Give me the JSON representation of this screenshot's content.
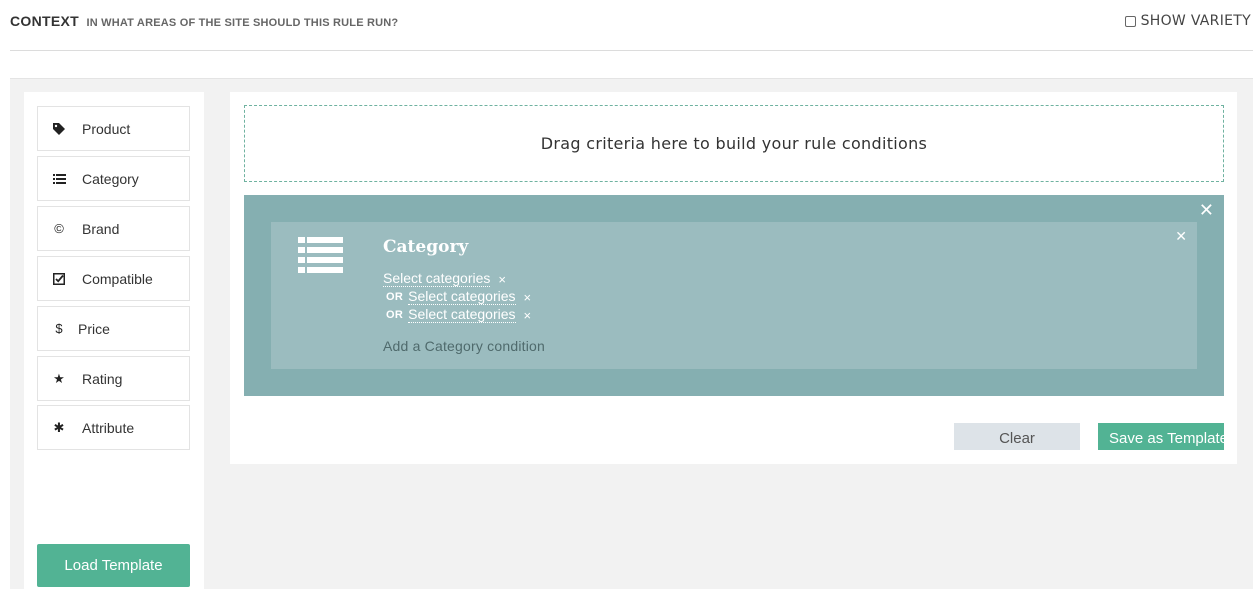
{
  "header": {
    "title": "CONTEXT",
    "subtitle": "IN WHAT AREAS OF THE SITE SHOULD THIS RULE RUN?",
    "show_variety_label": "SHOW VARIETY",
    "show_variety_checked": false
  },
  "sidebar": {
    "items": [
      {
        "label": "Product",
        "icon": "tag-icon"
      },
      {
        "label": "Category",
        "icon": "list-icon"
      },
      {
        "label": "Brand",
        "icon": "copyright-icon"
      },
      {
        "label": "Compatible",
        "icon": "check-square-icon"
      },
      {
        "label": "Price",
        "icon": "dollar-icon"
      },
      {
        "label": "Rating",
        "icon": "star-icon"
      },
      {
        "label": "Attribute",
        "icon": "asterisk-icon"
      }
    ],
    "load_template_label": "Load Template"
  },
  "builder": {
    "dropzone_text": "Drag criteria here to build your rule conditions",
    "condition": {
      "title": "Category",
      "first_link": "Select categories",
      "or_rows": [
        {
          "or_label": "OR",
          "link": "Select categories"
        },
        {
          "or_label": "OR",
          "link": "Select categories"
        }
      ],
      "add_label": "Add a Category condition"
    },
    "clear_label": "Clear",
    "save_label": "Save as Template"
  },
  "colors": {
    "accent": "#52b394",
    "condition_outer": "#85afb1",
    "condition_inner": "#9bbcbf",
    "panel_bg": "#f2f2f2"
  }
}
